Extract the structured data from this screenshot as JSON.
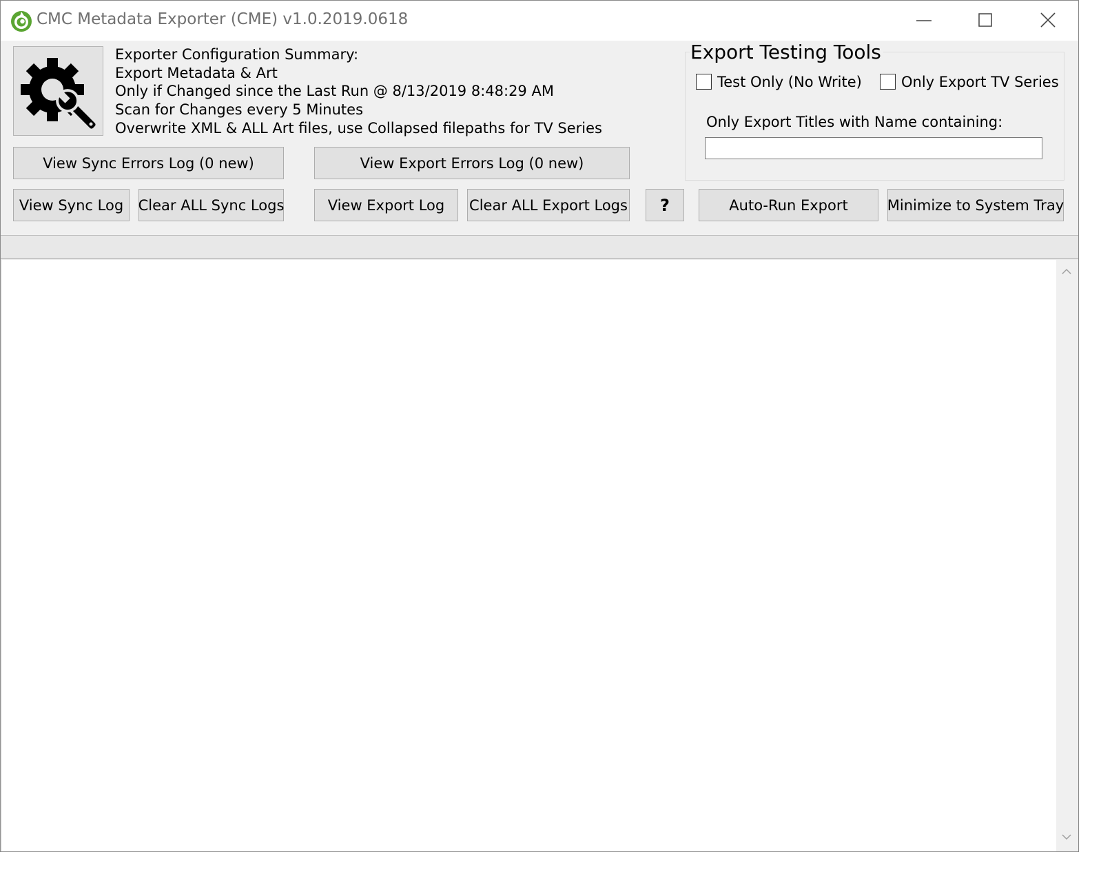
{
  "window": {
    "title": "CMC Metadata Exporter (CME) v1.0.2019.0618",
    "controls": [
      "minimize-icon",
      "maximize-icon",
      "close-icon"
    ]
  },
  "config_summary": {
    "icon": "gear-wrench-icon",
    "lines": [
      "Exporter Configuration Summary:",
      "Export Metadata & Art",
      "Only if Changed since the Last Run @ 8/13/2019 8:48:29 AM",
      "Scan for Changes every 5 Minutes",
      "Overwrite XML & ALL Art files, use Collapsed filepaths for TV Series"
    ]
  },
  "buttons": {
    "view_sync_errors": "View Sync Errors Log (0 new)",
    "view_export_errors": "View Export Errors Log (0 new)",
    "view_sync_log": "View Sync Log",
    "clear_sync_logs": "Clear ALL Sync Logs",
    "view_export_log": "View Export Log",
    "clear_export_logs": "Clear ALL Export Logs",
    "help": "?",
    "auto_run_export": "Auto-Run Export",
    "minimize_tray": "Minimize to System Tray"
  },
  "testing_tools": {
    "title": "Export Testing Tools",
    "test_only_label": "Test Only (No Write)",
    "test_only_checked": false,
    "tv_only_label": "Only Export TV Series",
    "tv_only_checked": false,
    "filter_label": "Only Export Titles with Name containing:",
    "filter_value": ""
  },
  "colors": {
    "window_bg": "#f0f0f0",
    "button_bg": "#e1e1e1",
    "app_icon_green": "#5aa532"
  }
}
